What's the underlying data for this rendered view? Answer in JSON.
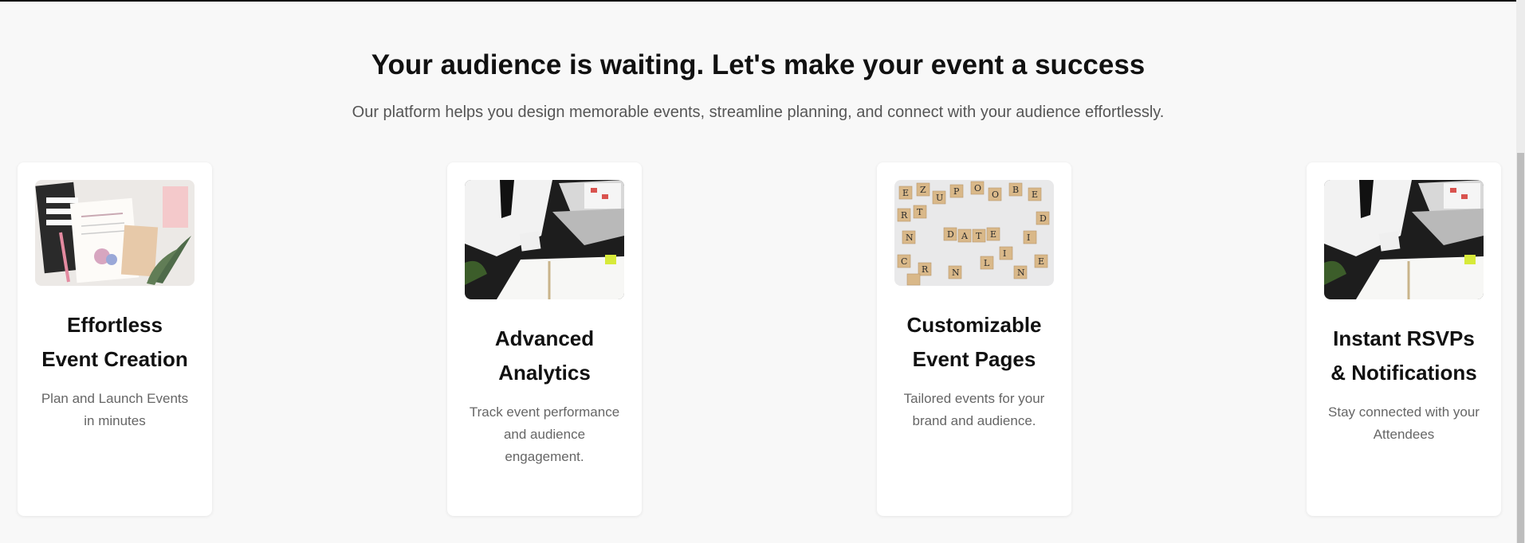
{
  "section": {
    "headline": "Your audience is waiting. Let's make your event a success",
    "subhead": "Our platform helps you design memorable events, streamline planning, and connect with your audience effortlessly."
  },
  "cards": [
    {
      "title_line1": "Effortless",
      "title_line2": "Event Creation",
      "desc_line1": "Plan and Launch Events",
      "desc_line2": "in minutes",
      "desc_line3": ""
    },
    {
      "title_line1": "Advanced",
      "title_line2": "Analytics",
      "desc_line1": "Track event performance",
      "desc_line2": "and audience",
      "desc_line3": "engagement."
    },
    {
      "title_line1": "Customizable",
      "title_line2": "Event Pages",
      "desc_line1": "Tailored events for your",
      "desc_line2": "brand and audience.",
      "desc_line3": ""
    },
    {
      "title_line1": "Instant RSVPs",
      "title_line2": "& Notifications",
      "desc_line1": "Stay connected with your",
      "desc_line2": "Attendees",
      "desc_line3": ""
    }
  ]
}
